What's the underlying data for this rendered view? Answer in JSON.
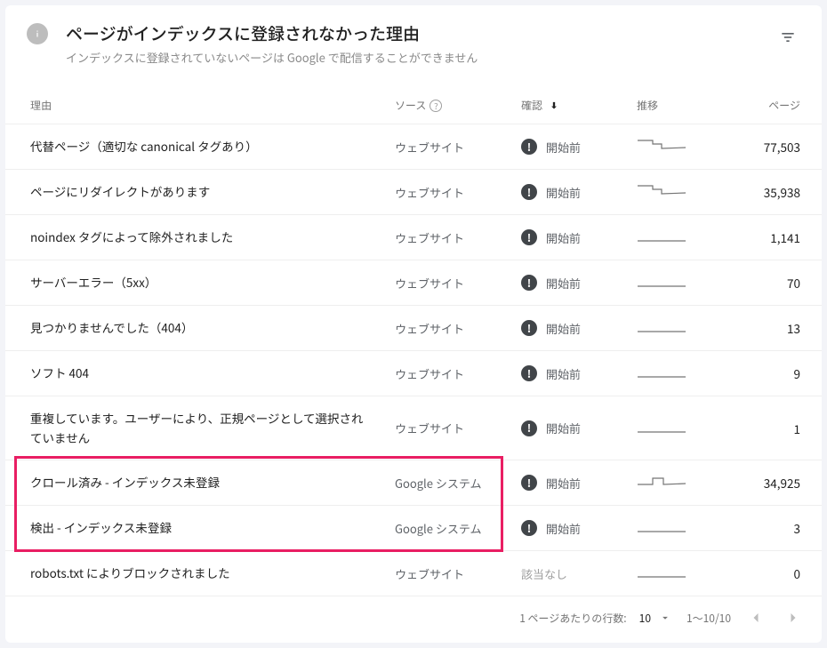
{
  "header": {
    "title": "ページがインデックスに登録されなかった理由",
    "subtitle": "インデックスに登録されていないページは Google で配信することができません"
  },
  "columns": {
    "reason": "理由",
    "source": "ソース",
    "status": "確認",
    "trend": "推移",
    "pages": "ページ"
  },
  "status_labels": {
    "before_start": "開始前",
    "na": "該当なし"
  },
  "source_labels": {
    "website": "ウェブサイト",
    "google": "Google システム"
  },
  "rows": [
    {
      "reason": "代替ページ（適切な canonical タグあり）",
      "source": "website",
      "status": "before_start",
      "trend": "step_down",
      "pages": "77,503"
    },
    {
      "reason": "ページにリダイレクトがあります",
      "source": "website",
      "status": "before_start",
      "trend": "step_down",
      "pages": "35,938"
    },
    {
      "reason": "noindex タグによって除外されました",
      "source": "website",
      "status": "before_start",
      "trend": "flat_low",
      "pages": "1,141"
    },
    {
      "reason": "サーバーエラー（5xx）",
      "source": "website",
      "status": "before_start",
      "trend": "flat_low",
      "pages": "70"
    },
    {
      "reason": "見つかりませんでした（404）",
      "source": "website",
      "status": "before_start",
      "trend": "flat_low",
      "pages": "13"
    },
    {
      "reason": "ソフト 404",
      "source": "website",
      "status": "before_start",
      "trend": "flat_low",
      "pages": "9"
    },
    {
      "reason": "重複しています。ユーザーにより、正規ページとして選択されていません",
      "source": "website",
      "status": "before_start",
      "trend": "flat_low",
      "pages": "1"
    },
    {
      "reason": "クロール済み - インデックス未登録",
      "source": "google",
      "status": "before_start",
      "trend": "bump",
      "pages": "34,925"
    },
    {
      "reason": "検出 - インデックス未登録",
      "source": "google",
      "status": "before_start",
      "trend": "flat_low",
      "pages": "3"
    },
    {
      "reason": "robots.txt によりブロックされました",
      "source": "website",
      "status": "na",
      "trend": "flat_low",
      "pages": "0"
    }
  ],
  "highlight": {
    "start_row_index": 7,
    "end_row_index": 8,
    "cover_cols": "reason_source"
  },
  "footer": {
    "rows_label": "1 ページあたりの行数:",
    "rows_value": "10",
    "range": "1～10/10"
  }
}
